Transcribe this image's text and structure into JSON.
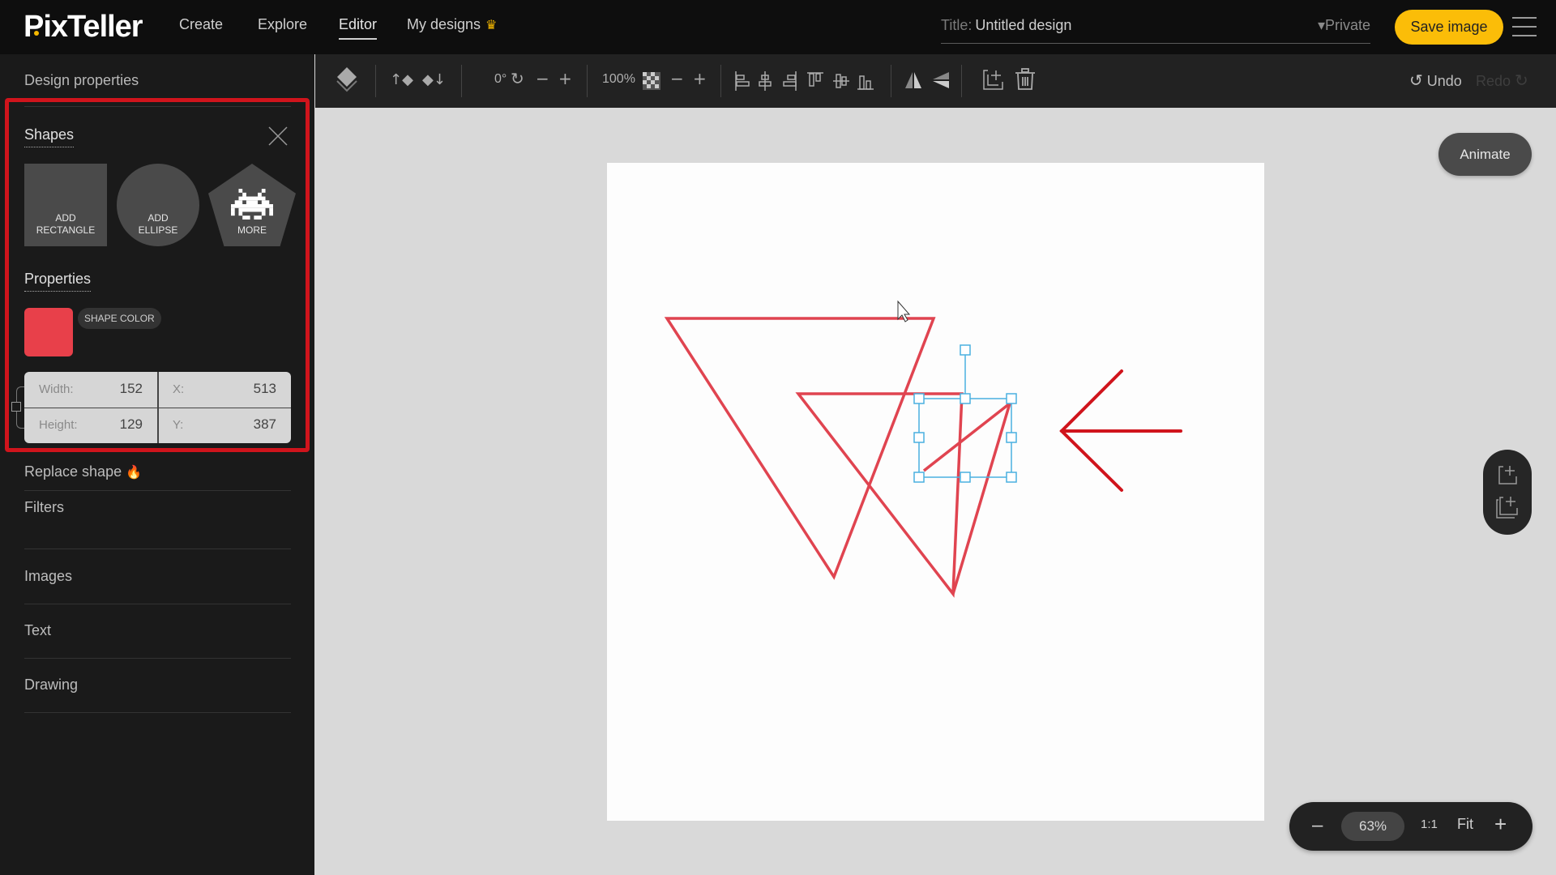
{
  "app": {
    "logo": "PixTeller",
    "nav": [
      {
        "label": "Create",
        "active": false
      },
      {
        "label": "Explore",
        "active": false
      },
      {
        "label": "Editor",
        "active": true
      },
      {
        "label": "My designs",
        "active": false,
        "icon": "crown-icon"
      }
    ],
    "title_label": "Title:",
    "title_value": "Untitled design",
    "privacy": "▾Private",
    "save_label": "Save image",
    "menu_icon": "hamburger-icon"
  },
  "toolbar": {
    "rotation": "0°",
    "opacity": "100%",
    "undo_label": "Undo",
    "redo_label": "Redo"
  },
  "sidebar": {
    "title": "Design properties",
    "shapes": {
      "heading": "Shapes",
      "tiles": [
        {
          "line1": "ADD",
          "line2": "RECTANGLE"
        },
        {
          "line1": "ADD",
          "line2": "ELLIPSE"
        },
        {
          "line1": "",
          "line2": "MORE"
        }
      ]
    },
    "properties": {
      "heading": "Properties",
      "shape_color_label": "SHAPE COLOR",
      "shape_color": "#e8404a",
      "width_label": "Width:",
      "width": "152",
      "height_label": "Height:",
      "height": "129",
      "x_label": "X:",
      "x": "513",
      "y_label": "Y:",
      "y": "387"
    },
    "items": [
      {
        "label": "Replace shape"
      },
      {
        "label": "Filters"
      },
      {
        "label": "Images"
      },
      {
        "label": "Text"
      },
      {
        "label": "Drawing"
      }
    ]
  },
  "canvas": {
    "animate_label": "Animate",
    "stroke_color": "#e04450",
    "selection_color": "#4ab0e0",
    "annotation_color": "#d0141c"
  },
  "zoom": {
    "minus": "–",
    "value": "63%",
    "one_to_one": "1:1",
    "fit": "Fit",
    "plus": "+"
  }
}
